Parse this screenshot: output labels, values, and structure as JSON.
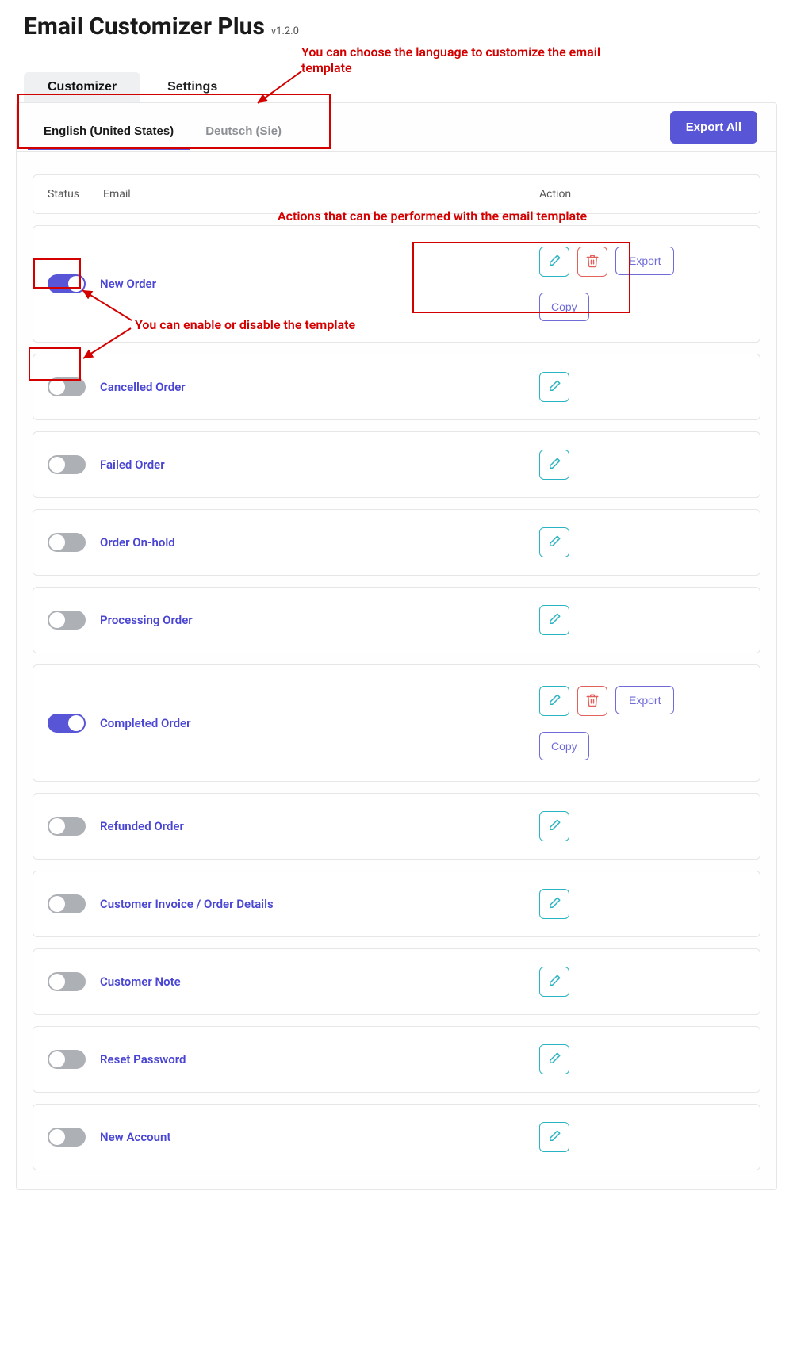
{
  "header": {
    "title": "Email Customizer Plus",
    "version": "v1.2.0"
  },
  "topTabs": {
    "customizer": "Customizer",
    "settings": "Settings"
  },
  "languages": {
    "en": "English (United States)",
    "de": "Deutsch (Sie)"
  },
  "exportAll": "Export All",
  "columns": {
    "status": "Status",
    "email": "Email",
    "action": "Action"
  },
  "actions": {
    "export": "Export",
    "copy": "Copy"
  },
  "templates": [
    {
      "name": "New Order",
      "enabled": true,
      "full_actions": true
    },
    {
      "name": "Cancelled Order",
      "enabled": false,
      "full_actions": false
    },
    {
      "name": "Failed Order",
      "enabled": false,
      "full_actions": false
    },
    {
      "name": "Order On-hold",
      "enabled": false,
      "full_actions": false
    },
    {
      "name": "Processing Order",
      "enabled": false,
      "full_actions": false
    },
    {
      "name": "Completed Order",
      "enabled": true,
      "full_actions": true
    },
    {
      "name": "Refunded Order",
      "enabled": false,
      "full_actions": false
    },
    {
      "name": "Customer Invoice / Order Details",
      "enabled": false,
      "full_actions": false
    },
    {
      "name": "Customer Note",
      "enabled": false,
      "full_actions": false
    },
    {
      "name": "Reset Password",
      "enabled": false,
      "full_actions": false
    },
    {
      "name": "New Account",
      "enabled": false,
      "full_actions": false
    }
  ],
  "annotations": {
    "lang": "You can choose the language to customize the email template",
    "actions": "Actions that can be performed with the email template",
    "toggle": "You can enable or disable the template"
  },
  "colors": {
    "accent": "#5856d6",
    "link": "#4a46d3",
    "edit": "#2ab3c2",
    "delete": "#e2615b",
    "ann": "#d40000"
  }
}
